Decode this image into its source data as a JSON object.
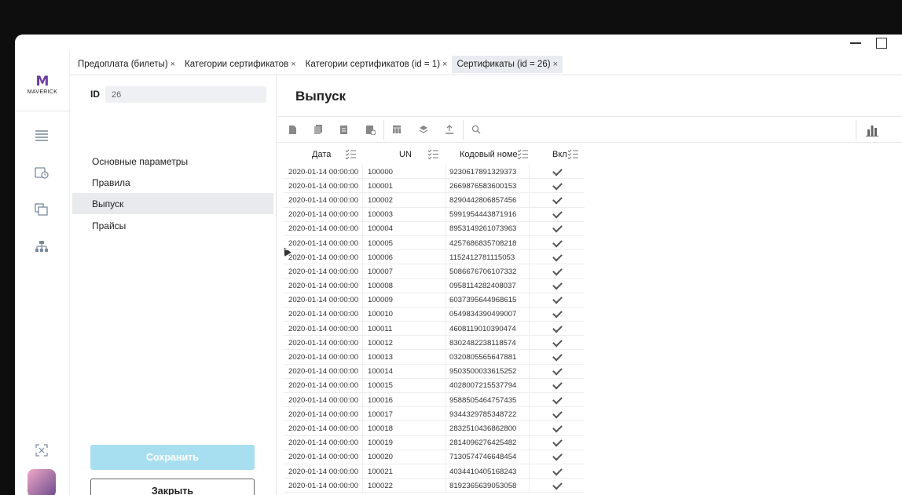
{
  "app": {
    "logo_text": "MAVERICK"
  },
  "tabs": [
    {
      "label": "Предоплата (билеты)",
      "active": false
    },
    {
      "label": "Категории сертификатов",
      "active": false
    },
    {
      "label": "Категории сертификатов (id = 1)",
      "active": false
    },
    {
      "label": "Сертификаты (id = 26)",
      "active": true
    }
  ],
  "tab_close_glyph": "×",
  "side": {
    "id_label": "ID",
    "id_value": "26",
    "nav": [
      {
        "label": "Основные параметры",
        "active": false
      },
      {
        "label": "Правила",
        "active": false
      },
      {
        "label": "Выпуск",
        "active": true
      },
      {
        "label": "Прайсы",
        "active": false
      }
    ],
    "save_label": "Сохранить",
    "close_label": "Закрыть"
  },
  "main": {
    "title": "Выпуск",
    "columns": {
      "date": "Дата",
      "un": "UN",
      "code": "Кодовый номе",
      "included": "Вкл"
    },
    "rows": [
      {
        "date": "2020-01-14 00:00:00",
        "un": "100000",
        "code": "9230617891329373",
        "included": true
      },
      {
        "date": "2020-01-14 00:00:00",
        "un": "100001",
        "code": "2669876583600153",
        "included": true
      },
      {
        "date": "2020-01-14 00:00:00",
        "un": "100002",
        "code": "8290442806857456",
        "included": true
      },
      {
        "date": "2020-01-14 00:00:00",
        "un": "100003",
        "code": "5991954443871916",
        "included": true
      },
      {
        "date": "2020-01-14 00:00:00",
        "un": "100004",
        "code": "8953149261073963",
        "included": true
      },
      {
        "date": "2020-01-14 00:00:00",
        "un": "100005",
        "code": "4257686835708218",
        "included": true
      },
      {
        "date": "2020-01-14 00:00:00",
        "un": "100006",
        "code": "1152412781115053",
        "included": true
      },
      {
        "date": "2020-01-14 00:00:00",
        "un": "100007",
        "code": "5086676706107332",
        "included": true
      },
      {
        "date": "2020-01-14 00:00:00",
        "un": "100008",
        "code": "0958114282408037",
        "included": true
      },
      {
        "date": "2020-01-14 00:00:00",
        "un": "100009",
        "code": "6037395644968615",
        "included": true
      },
      {
        "date": "2020-01-14 00:00:00",
        "un": "100010",
        "code": "0549834390499007",
        "included": true
      },
      {
        "date": "2020-01-14 00:00:00",
        "un": "100011",
        "code": "4608119010390474",
        "included": true
      },
      {
        "date": "2020-01-14 00:00:00",
        "un": "100012",
        "code": "8302482238118574",
        "included": true
      },
      {
        "date": "2020-01-14 00:00:00",
        "un": "100013",
        "code": "0320805565647881",
        "included": true
      },
      {
        "date": "2020-01-14 00:00:00",
        "un": "100014",
        "code": "9503500033615252",
        "included": true
      },
      {
        "date": "2020-01-14 00:00:00",
        "un": "100015",
        "code": "4028007215537794",
        "included": true
      },
      {
        "date": "2020-01-14 00:00:00",
        "un": "100016",
        "code": "9588505464757435",
        "included": true
      },
      {
        "date": "2020-01-14 00:00:00",
        "un": "100017",
        "code": "9344329785348722",
        "included": true
      },
      {
        "date": "2020-01-14 00:00:00",
        "un": "100018",
        "code": "2832510436862800",
        "included": true
      },
      {
        "date": "2020-01-14 00:00:00",
        "un": "100019",
        "code": "2814096276425482",
        "included": true
      },
      {
        "date": "2020-01-14 00:00:00",
        "un": "100020",
        "code": "7130574746648454",
        "included": true
      },
      {
        "date": "2020-01-14 00:00:00",
        "un": "100021",
        "code": "4034410405168243",
        "included": true
      },
      {
        "date": "2020-01-14 00:00:00",
        "un": "100022",
        "code": "8192365639053058",
        "included": true
      }
    ]
  },
  "colors": {
    "save_button": "#a8dff0",
    "active_tab": "#e8ecf0",
    "logo_purple": "#6a3fa0",
    "logo_pink": "#e0436b"
  }
}
